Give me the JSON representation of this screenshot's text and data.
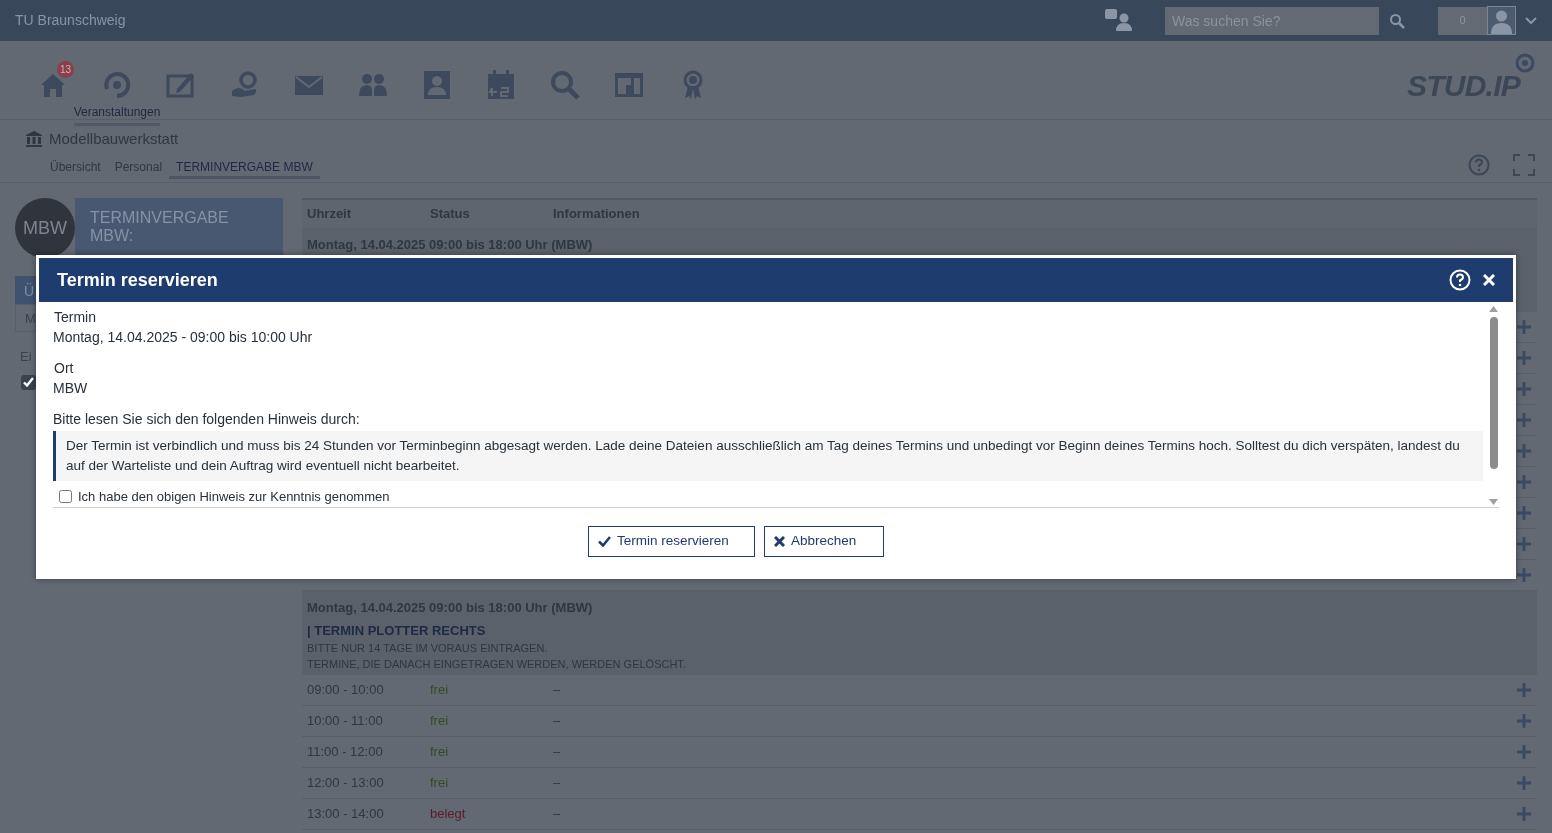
{
  "topbar": {
    "brand": "TU Braunschweig",
    "search": {
      "placeholder": "Was suchen Sie?"
    },
    "counter": "0"
  },
  "nav": {
    "items": [
      {
        "kind": "home",
        "badge": "13",
        "selected": false
      },
      {
        "kind": "courses",
        "label": "Veranstaltungen",
        "selected": true
      },
      {
        "kind": "edit",
        "selected": false
      },
      {
        "kind": "hand",
        "selected": false
      },
      {
        "kind": "mail",
        "selected": false
      },
      {
        "kind": "people",
        "selected": false
      },
      {
        "kind": "profile",
        "selected": false
      },
      {
        "kind": "calendar",
        "selected": false
      },
      {
        "kind": "search",
        "selected": false
      },
      {
        "kind": "layout",
        "selected": false
      },
      {
        "kind": "award",
        "selected": false
      }
    ],
    "logo": "STUD.IP"
  },
  "context": {
    "title": "Modellbauwerkstatt",
    "tabs": [
      {
        "label": "Übersicht",
        "selected": false
      },
      {
        "label": "Personal",
        "selected": false
      },
      {
        "label": "TERMINVERGABE MBW",
        "selected": true
      }
    ]
  },
  "sidebar": {
    "logo": "MBW",
    "widget_title": "TERMINVERGABE MBW:",
    "items": [
      {
        "kind": "header",
        "label": "Ü"
      },
      {
        "kind": "link",
        "label": "M"
      },
      {
        "kind": "heading",
        "label": "Ei"
      },
      {
        "kind": "checkbox",
        "checked": true
      }
    ]
  },
  "table": {
    "columns": [
      "Uhrzeit",
      "Status",
      "Informationen"
    ],
    "groups": [
      {
        "title": "Montag, 14.04.2025 09:00 bis 18:00 Uhr (MBW)",
        "rows": [
          {
            "kind": "covered"
          },
          {
            "kind": "covered"
          },
          {
            "kind": "covered"
          },
          {
            "kind": "covered"
          },
          {
            "kind": "covered"
          },
          {
            "kind": "covered"
          },
          {
            "kind": "covered"
          },
          {
            "kind": "covered"
          },
          {
            "kind": "covered"
          }
        ]
      },
      {
        "title": "Montag, 14.04.2025 09:00 bis 18:00 Uhr (MBW)",
        "subtitle": "| TERMIN PLOTTER RECHTS",
        "notes": [
          "BITTE NUR 14 TAGE IM VORAUS EINTRAGEN.",
          "TERMINE, DIE DANACH EINGETRAGEN WERDEN, WERDEN GELÖSCHT."
        ],
        "rows": [
          {
            "kind": "slot",
            "time": "09:00 - 10:00",
            "status": "frei",
            "color": "#2f4d1f",
            "info": "–"
          },
          {
            "kind": "slot",
            "time": "10:00 - 11:00",
            "status": "frei",
            "color": "#2f4d1f",
            "info": "–"
          },
          {
            "kind": "slot",
            "time": "11:00 - 12:00",
            "status": "frei",
            "color": "#2f4d1f",
            "info": "–"
          },
          {
            "kind": "slot",
            "time": "12:00 - 13:00",
            "status": "frei",
            "color": "#2f4d1f",
            "info": "–"
          },
          {
            "kind": "slot",
            "time": "13:00 - 14:00",
            "status": "belegt",
            "color": "#5e1a28",
            "info": "–"
          }
        ]
      }
    ]
  },
  "dialog": {
    "title": "Termin reservieren",
    "fields": [
      {
        "label": "Termin",
        "value": "Montag, 14.04.2025 - 09:00 bis 10:00 Uhr"
      },
      {
        "label": "Ort",
        "value": "MBW"
      }
    ],
    "hint_intro": "Bitte lesen Sie sich den folgenden Hinweis durch:",
    "hint": "Der Termin ist verbindlich und muss bis 24 Stunden vor Terminbeginn abgesagt werden. Lade deine Dateien ausschließlich am Tag deines Termins und unbedingt vor Beginn deines Termins hoch. Solltest du dich verspäten, landest du auf der Warteliste und dein Auftrag wird eventuell nicht bearbeitet.",
    "confirm": {
      "label": "Ich habe den obigen Hinweis zur Kenntnis genommen",
      "checked": false
    },
    "buttons": [
      {
        "kind": "confirm",
        "label": "Termin reservieren"
      },
      {
        "kind": "cancel",
        "label": "Abbrechen"
      }
    ]
  }
}
